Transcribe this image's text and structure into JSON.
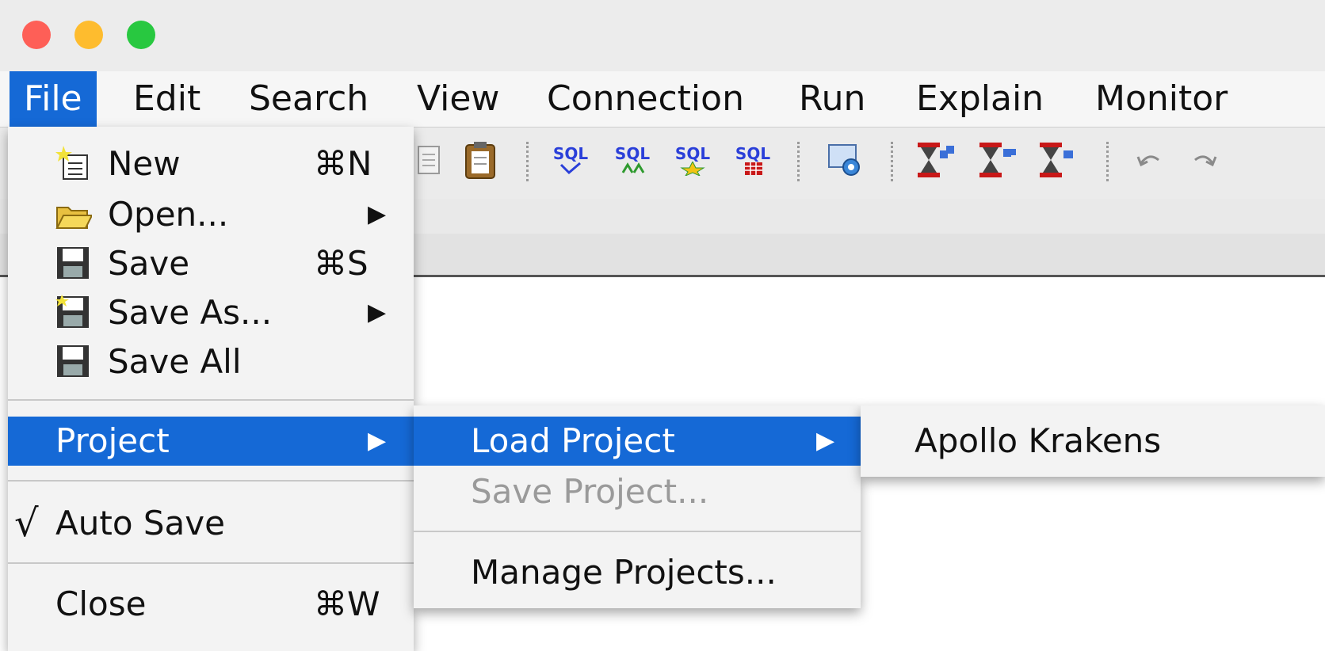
{
  "window": {
    "traffic_lights": {
      "close": "#fe5f57",
      "minimize": "#febc2e",
      "zoom": "#28c840"
    }
  },
  "menubar": {
    "items": [
      "File",
      "Edit",
      "Search",
      "View",
      "Connection",
      "Run",
      "Explain",
      "Monitor"
    ]
  },
  "toolbar": {
    "sql_label": "SQL"
  },
  "file_menu": {
    "new": {
      "label": "New",
      "shortcut": "⌘N"
    },
    "open": {
      "label": "Open..."
    },
    "save": {
      "label": "Save",
      "shortcut": "⌘S"
    },
    "save_as": {
      "label": "Save As..."
    },
    "save_all": {
      "label": "Save All"
    },
    "project": {
      "label": "Project"
    },
    "auto_save": {
      "label": "Auto Save",
      "checkmark": "√"
    },
    "close": {
      "label": "Close",
      "shortcut": "⌘W"
    }
  },
  "project_menu": {
    "load_project": "Load Project",
    "save_project": "Save Project...",
    "manage_projects": "Manage Projects..."
  },
  "load_project_menu": {
    "items": [
      "Apollo Krakens"
    ]
  },
  "colors": {
    "highlight": "#1569d6",
    "menu_bg": "#f3f3f3"
  }
}
